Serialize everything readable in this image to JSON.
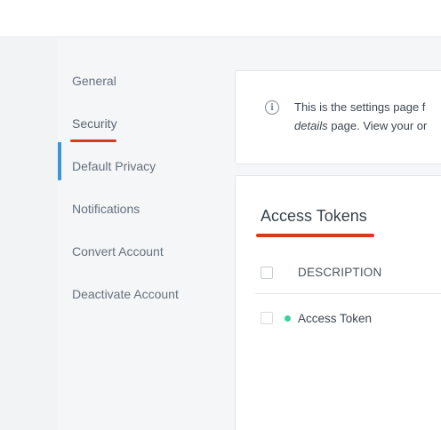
{
  "sidebar": {
    "items": [
      {
        "label": "General"
      },
      {
        "label": "Security",
        "active": true
      },
      {
        "label": "Default Privacy"
      },
      {
        "label": "Notifications"
      },
      {
        "label": "Convert Account"
      },
      {
        "label": "Deactivate Account"
      }
    ]
  },
  "info": {
    "icon": "info-icon",
    "line1": "This is the settings page f",
    "line2_em": "details",
    "line2_rest": " page. View your or"
  },
  "tokens": {
    "title": "Access Tokens",
    "column_header": "DESCRIPTION",
    "rows": [
      {
        "description": "Access Token",
        "status_color": "#3ccf9e"
      }
    ]
  },
  "colors": {
    "accent_active": "#3b95d8",
    "annotation_underline": "#d93a1f",
    "status_active": "#3ccf9e"
  }
}
